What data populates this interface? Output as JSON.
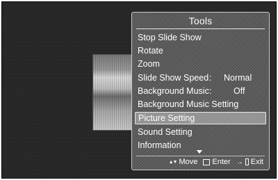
{
  "panel": {
    "title": "Tools"
  },
  "menu": {
    "items": [
      {
        "label": "Stop Slide Show"
      },
      {
        "label": "Rotate"
      },
      {
        "label": "Zoom"
      },
      {
        "label": "Slide Show Speed",
        "separator": ":",
        "value": "Normal"
      },
      {
        "label": "Background Music",
        "separator": ":",
        "value": "Off"
      },
      {
        "label": "Background Music Setting"
      },
      {
        "label": "Picture Setting",
        "selected": true
      },
      {
        "label": "Sound Setting"
      },
      {
        "label": "Information"
      }
    ]
  },
  "footer": {
    "move_icon": "up-down-arrows-icon",
    "move_glyph": "▲▼",
    "move_label": "Move",
    "enter_icon": "enter-icon",
    "enter_label": "Enter",
    "exit_icon": "exit-icon",
    "exit_glyph": "→",
    "exit_label": "Exit"
  },
  "colors": {
    "panel_bg": "#5a5a5a",
    "highlight_bg": "#8f8f8f",
    "text": "#ffffff"
  }
}
